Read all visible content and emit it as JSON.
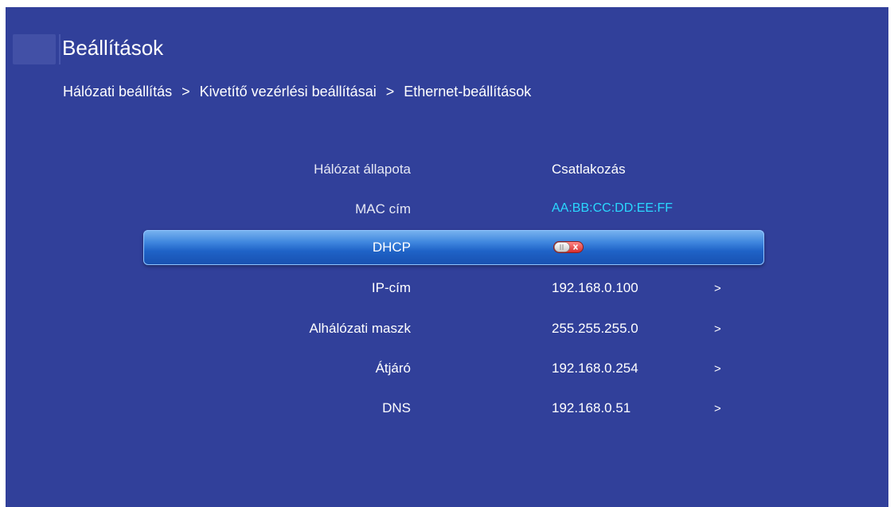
{
  "header": {
    "title": "Beállítások"
  },
  "breadcrumb": {
    "items": [
      "Hálózati beállítás",
      "Kivetítő vezérlési beállításai",
      "Ethernet-beállítások"
    ],
    "separator": ">"
  },
  "settings": {
    "rows": [
      {
        "label": "Hálózat állapota",
        "value": "Csatlakozás",
        "arrow": ""
      },
      {
        "label": "MAC cím",
        "value": "AA:BB:CC:DD:EE:FF",
        "arrow": ""
      },
      {
        "label": "DHCP",
        "value": "",
        "arrow": "",
        "toggle_state": "off"
      },
      {
        "label": "IP-cím",
        "value": "192.168.0.100",
        "arrow": ">"
      },
      {
        "label": "Alhálózati maszk",
        "value": "255.255.255.0",
        "arrow": ">"
      },
      {
        "label": "Átjáró",
        "value": "192.168.0.254",
        "arrow": ">"
      },
      {
        "label": "DNS",
        "value": "192.168.0.51",
        "arrow": ">"
      }
    ]
  },
  "colors": {
    "background": "#31409a",
    "mac_text": "#2ad8ff",
    "highlight": "#2f74d6",
    "toggle_off": "#e23b3b"
  }
}
